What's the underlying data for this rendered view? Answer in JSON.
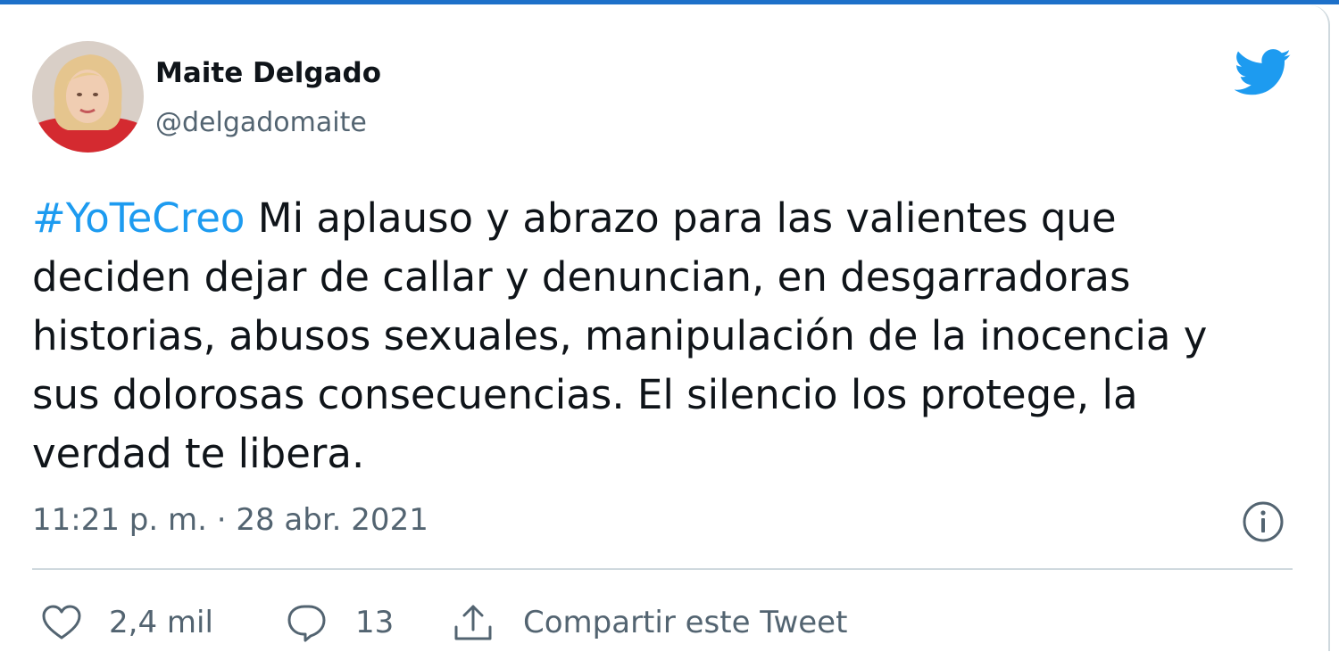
{
  "tweet": {
    "author_name": "Maite Delgado",
    "author_handle": "@delgadomaite",
    "hashtag": "#YoTeCreo",
    "text_line1": " Mi aplauso y abrazo para las valientes que",
    "text_line2": "deciden dejar de callar y denuncian, en desgarradoras",
    "text_line3": "historias, abusos sexuales, manipulación de la inocencia y",
    "text_line4": "sus dolorosas consecuencias. El silencio los protege, la",
    "text_line5": "verdad te libera.",
    "timestamp": "11:21 p. m. · 28 abr. 2021"
  },
  "actions": {
    "like_count": "2,4 mil",
    "reply_count": "13",
    "share_label": "Compartir este Tweet"
  },
  "icons": {
    "brand": "twitter-bird-icon",
    "info": "info-icon",
    "like": "heart-icon",
    "reply": "speech-bubble-icon",
    "share": "share-upload-icon"
  },
  "colors": {
    "brand_blue": "#1d9bf0",
    "hashtag_blue": "#1d9bf0",
    "text": "#0f1419",
    "secondary_text": "#536471",
    "divider": "#cfd9de"
  }
}
